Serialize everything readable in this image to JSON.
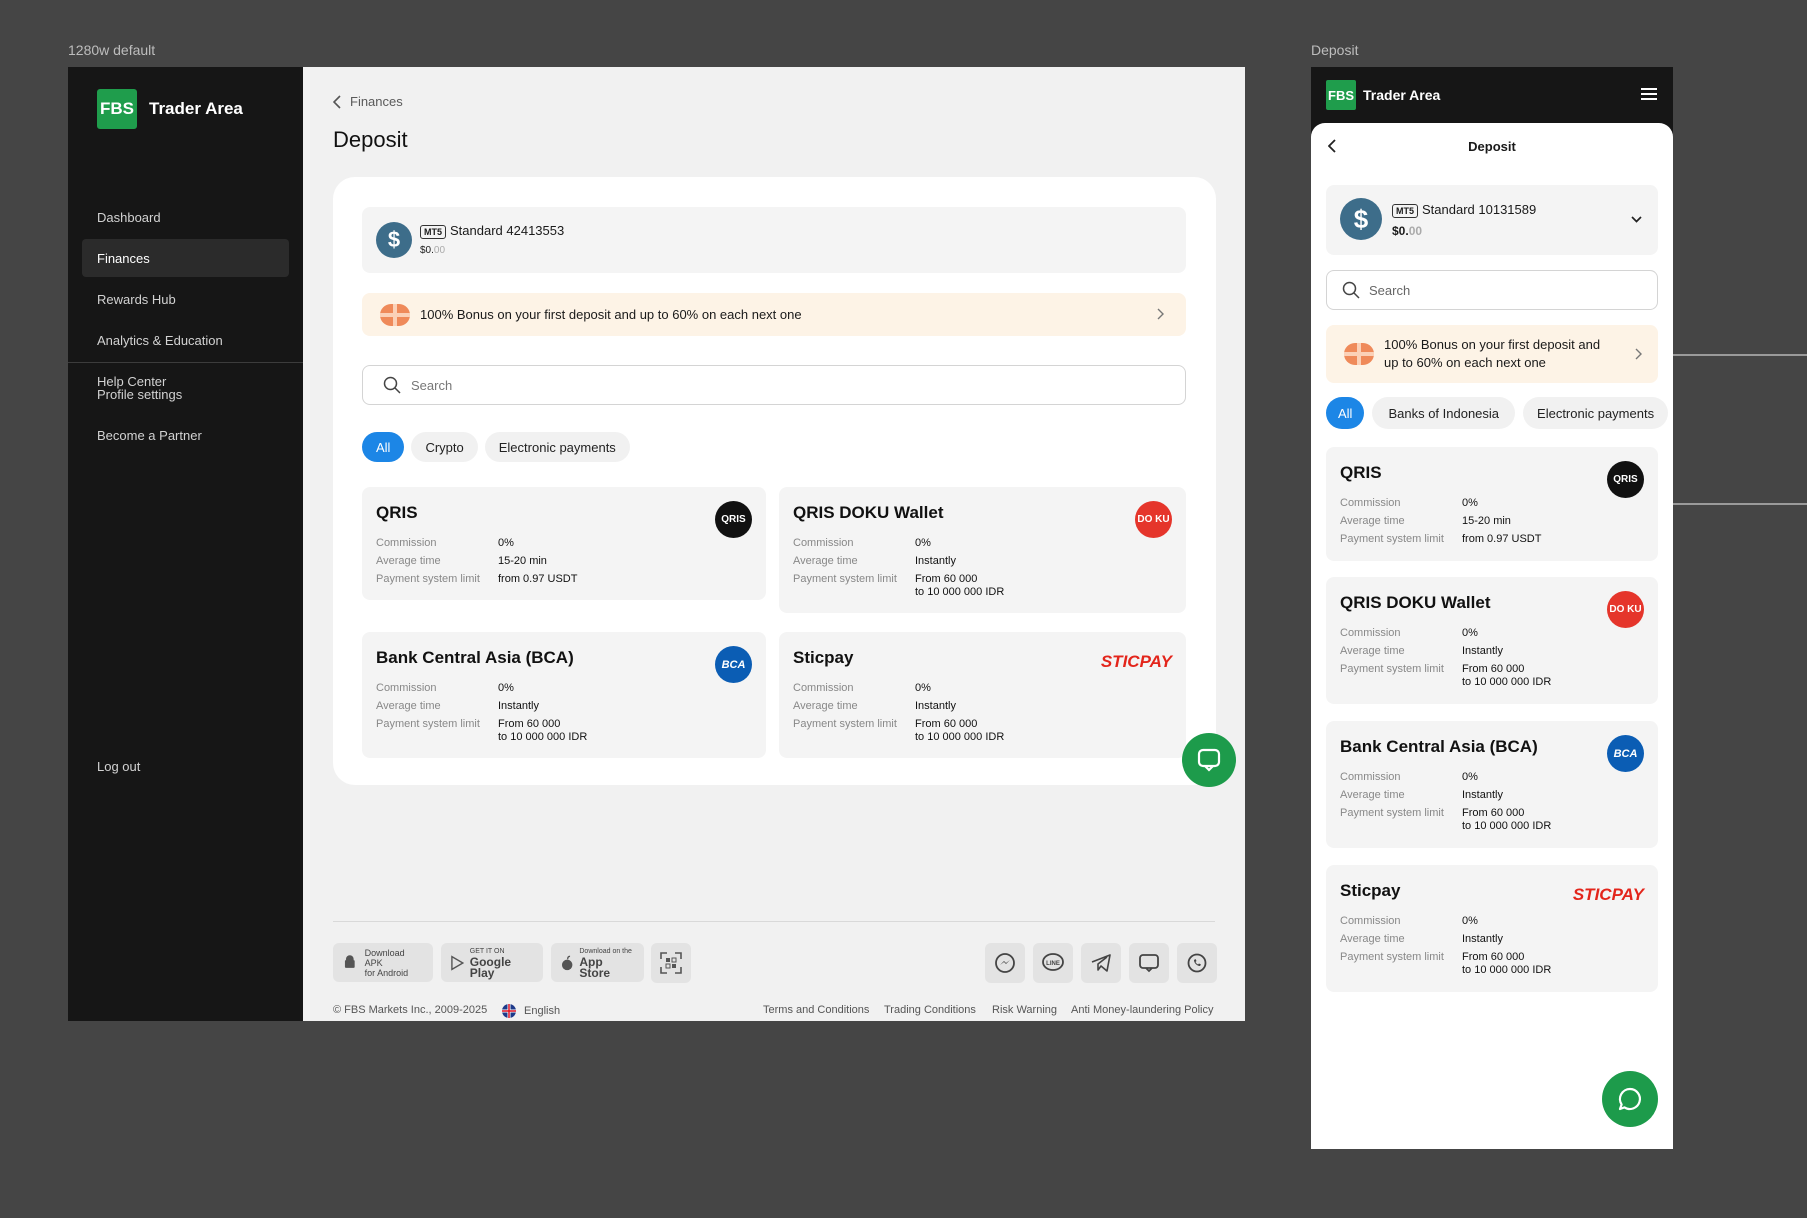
{
  "labels": {
    "desktop": "1280w default",
    "mobile": "Deposit"
  },
  "brand": {
    "logo": "FBS",
    "name": "Trader Area"
  },
  "sidebar": {
    "items": [
      {
        "label": "Dashboard"
      },
      {
        "label": "Finances"
      },
      {
        "label": "Rewards Hub"
      },
      {
        "label": "Analytics & Education"
      },
      {
        "label": "Help Center"
      }
    ],
    "secondary": [
      {
        "label": "Profile settings"
      },
      {
        "label": "Become a Partner"
      }
    ],
    "logout": "Log out"
  },
  "breadcrumb": "Finances",
  "page_title": "Deposit",
  "account": {
    "type": "MT5",
    "name": "Standard 42413553",
    "balance_main": "$0.",
    "balance_cents": "00"
  },
  "bonus": "100% Bonus on your first deposit and up to 60% on each next one",
  "search": {
    "placeholder": "Search"
  },
  "chips": [
    "All",
    "Crypto",
    "Electronic payments"
  ],
  "row_labels": {
    "commission": "Commission",
    "avg_time": "Average time",
    "limit": "Payment system limit"
  },
  "methods": [
    {
      "name": "QRIS",
      "commission": "0%",
      "time": "15-20 min",
      "limit": "from 0.97 USDT",
      "limit2": "",
      "logo": "QRIS"
    },
    {
      "name": "QRIS DOKU Wallet",
      "commission": "0%",
      "time": "Instantly",
      "limit": "From 60 000",
      "limit2": "to 10 000 000 IDR",
      "logo": "DO KU"
    },
    {
      "name": "Bank Central Asia (BCA)",
      "commission": "0%",
      "time": "Instantly",
      "limit": "From 60 000",
      "limit2": "to 10 000 000 IDR",
      "logo": "BCA"
    },
    {
      "name": "Sticpay",
      "commission": "0%",
      "time": "Instantly",
      "limit": "From 60 000",
      "limit2": "to 10 000 000 IDR",
      "logo": "STICPAY"
    }
  ],
  "footer": {
    "apk_small": "Download APK",
    "apk_big": "for Android",
    "gp_small": "GET IT ON",
    "gp_big": "Google Play",
    "as_small": "Download on the",
    "as_big": "App Store",
    "copyright": "© FBS Markets Inc., 2009-2025",
    "language": "English",
    "links": [
      "Terms and Conditions",
      "Trading Conditions",
      "Risk Warning",
      "Anti Money-laundering Policy"
    ]
  },
  "mobile": {
    "title": "Deposit",
    "account_name": "Standard 10131589",
    "balance_main": "$0.",
    "balance_cents": "00",
    "bonus": "100% Bonus on your first deposit and up to 60% on each next one",
    "chips": [
      "All",
      "Banks of Indonesia",
      "Electronic payments"
    ]
  },
  "colors": {
    "accent": "#1c86e6",
    "brand": "#1f9d4c",
    "sidebar": "#161616",
    "bonus_bg": "#fdf3e6"
  }
}
